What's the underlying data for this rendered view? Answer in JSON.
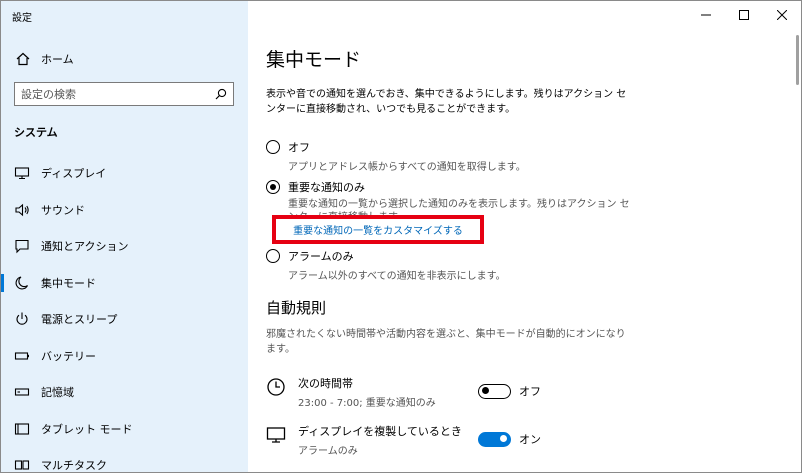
{
  "window": {
    "title": "設定"
  },
  "sidebar": {
    "home_label": "ホーム",
    "search_placeholder": "設定の検索",
    "section_label": "システム",
    "items": [
      {
        "label": "ディスプレイ",
        "icon": "display-icon"
      },
      {
        "label": "サウンド",
        "icon": "speaker-icon"
      },
      {
        "label": "通知とアクション",
        "icon": "notification-icon"
      },
      {
        "label": "集中モード",
        "icon": "moon-icon",
        "active": true
      },
      {
        "label": "電源とスリープ",
        "icon": "power-icon"
      },
      {
        "label": "バッテリー",
        "icon": "battery-icon"
      },
      {
        "label": "記憶域",
        "icon": "storage-icon"
      },
      {
        "label": "タブレット モード",
        "icon": "tablet-icon"
      },
      {
        "label": "マルチタスク",
        "icon": "multitask-icon"
      }
    ]
  },
  "main": {
    "title": "集中モード",
    "description": "表示や音での通知を選んでおき、集中できるようにします。残りはアクション センターに直接移動され、いつでも見ることができます。",
    "options": [
      {
        "label": "オフ",
        "sub": "アプリとアドレス帳からすべての通知を取得します。",
        "selected": false
      },
      {
        "label": "重要な通知のみ",
        "sub": "重要な通知の一覧から選択した通知のみを表示します。残りはアクション センターに直接移動します。",
        "selected": true
      },
      {
        "label": "アラームのみ",
        "sub": "アラーム以外のすべての通知を非表示にします。",
        "selected": false
      }
    ],
    "customize_link": "重要な通知の一覧をカスタマイズする",
    "auto_rules": {
      "title": "自動規則",
      "description": "邪魔されたくない時間帯や活動内容を選ぶと、集中モードが自動的にオンになります。",
      "rules": [
        {
          "name": "次の時間帯",
          "value": "23:00 - 7:00; 重要な通知のみ",
          "state": "オフ",
          "on": false,
          "icon": "clock-icon"
        },
        {
          "name": "ディスプレイを複製しているとき",
          "value": "アラームのみ",
          "state": "オン",
          "on": true,
          "icon": "monitor-icon"
        }
      ]
    }
  },
  "colors": {
    "sidebar_bg": "#e5f1fb",
    "accent": "#0078d7",
    "highlight_border": "#e60012",
    "link": "#0067b8"
  }
}
